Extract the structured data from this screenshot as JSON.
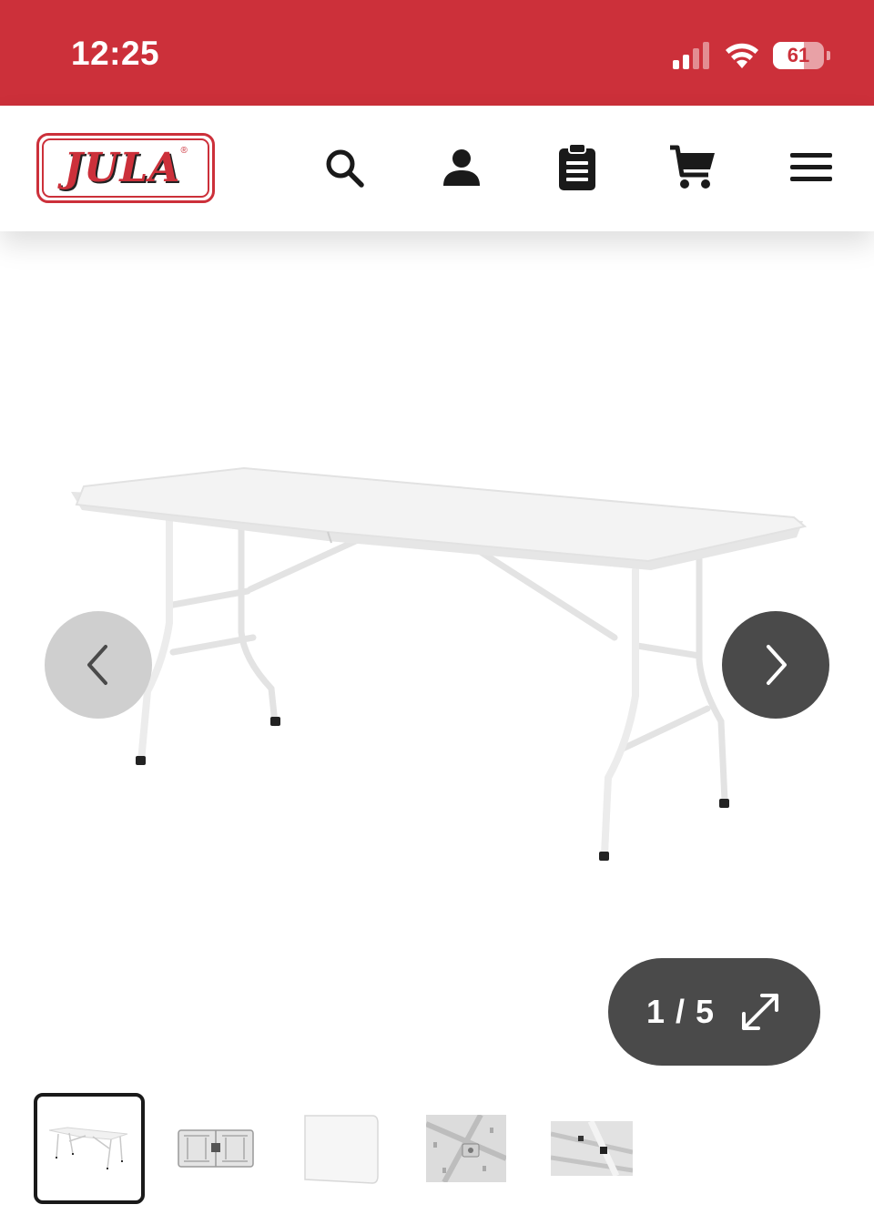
{
  "status_bar": {
    "time": "12:25",
    "battery": "61",
    "battery_level": 0.61
  },
  "header": {
    "logo_text": "JULA",
    "logo_reg": "®",
    "icons": [
      "search-icon",
      "account-icon",
      "shopping-list-icon",
      "cart-icon",
      "menu-icon"
    ]
  },
  "gallery": {
    "counter": "1 / 5",
    "current": 1,
    "total": 5
  },
  "thumbnails": [
    {
      "name": "table-standing",
      "active": true
    },
    {
      "name": "table-folded",
      "active": false
    },
    {
      "name": "table-top",
      "active": false
    },
    {
      "name": "hinge-detail",
      "active": false
    },
    {
      "name": "leg-detail",
      "active": false
    }
  ],
  "colors": {
    "brand_red": "#cc303a",
    "button_dark": "#4a4a4a",
    "button_light": "#cfcfcf"
  }
}
